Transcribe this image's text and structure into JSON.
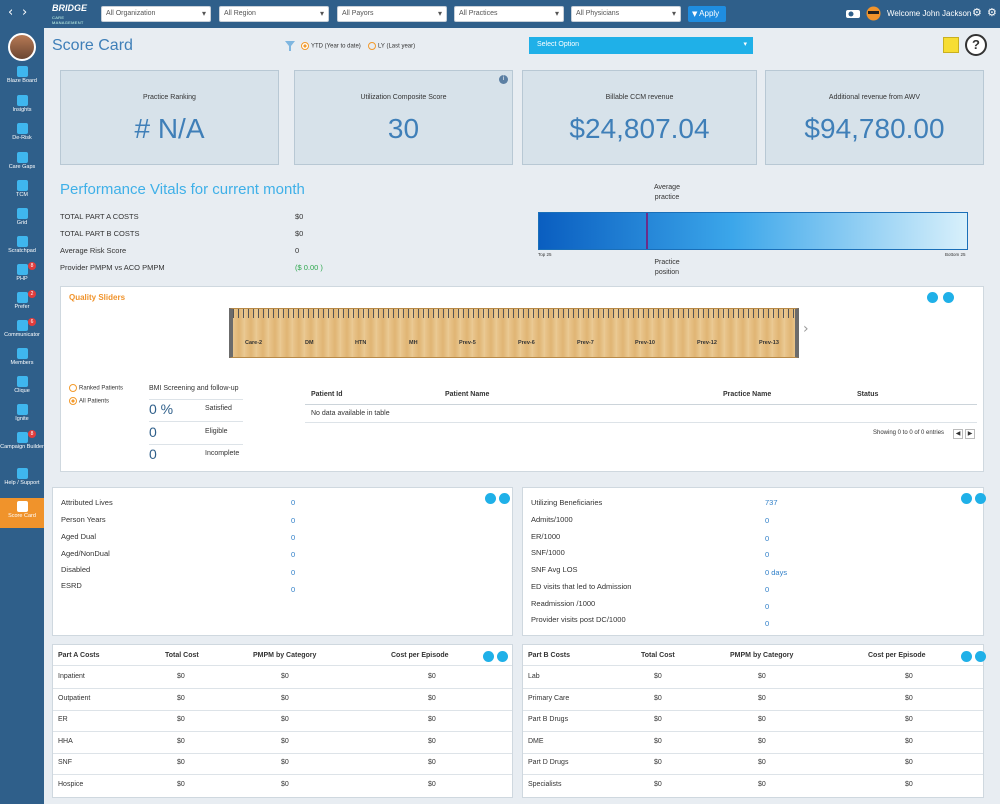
{
  "topbar": {
    "logo_text": "BRIDGE",
    "logo_sub": "CARE MANAGEMENT",
    "filters": [
      "All Organization",
      "All Region",
      "All Payors",
      "All Practices",
      "All Physicians"
    ],
    "apply_label": "Apply",
    "welcome": "Welcome John Jackson"
  },
  "sidebar": {
    "items": [
      {
        "label": "Blaze Board",
        "badge": ""
      },
      {
        "label": "Insights",
        "badge": ""
      },
      {
        "label": "De-Risk",
        "badge": ""
      },
      {
        "label": "Care Gaps",
        "badge": ""
      },
      {
        "label": "TCM",
        "badge": ""
      },
      {
        "label": "Grid",
        "badge": ""
      },
      {
        "label": "Scratchpad",
        "badge": ""
      },
      {
        "label": "PHP",
        "badge": "8"
      },
      {
        "label": "Prefer",
        "badge": "2"
      },
      {
        "label": "Communicator",
        "badge": "6"
      },
      {
        "label": "Members",
        "badge": ""
      },
      {
        "label": "Clique",
        "badge": ""
      },
      {
        "label": "Ignite",
        "badge": ""
      },
      {
        "label": "Campaign Builder",
        "badge": "8"
      },
      {
        "label": "Help / Support",
        "badge": ""
      },
      {
        "label": "Score Card",
        "badge": ""
      }
    ]
  },
  "header": {
    "title": "Score Card",
    "radio_ytd": "YTD (Year to date)",
    "radio_ly": "LY (Last year)",
    "select_option": "Select Option"
  },
  "kpis": [
    {
      "label": "Practice Ranking",
      "value": "# N/A"
    },
    {
      "label": "Utilization Composite Score",
      "value": "30"
    },
    {
      "label": "Billable CCM revenue",
      "value": "$24,807.04"
    },
    {
      "label": "Additional revenue from AWV",
      "value": "$94,780.00"
    }
  ],
  "vitals": {
    "title": "Performance Vitals for current month",
    "rows": [
      {
        "label": "TOTAL PART A COSTS",
        "value": "$0"
      },
      {
        "label": "TOTAL PART B COSTS",
        "value": "$0"
      },
      {
        "label": "Average Risk Score",
        "value": "0"
      },
      {
        "label": "Provider PMPM vs ACO PMPM",
        "value": "($ 0.00 )"
      }
    ],
    "gradient_top_label": "Average practice",
    "gradient_bottom_label": "Practice position",
    "gradient_left": "Top 25",
    "gradient_right": "Bottom 25",
    "average_marker_fraction": 0.25
  },
  "quality": {
    "title": "Quality Sliders",
    "ruler_ticks": [
      "Care-2",
      "DM",
      "HTN",
      "MH",
      "Prev-5",
      "Prev-6",
      "Prev-7",
      "Prev-10",
      "Prev-12",
      "Prev-13"
    ],
    "radio_ranked": "Ranked Patients",
    "radio_all": "All Patients",
    "bmi_title": "BMI Screening and follow-up",
    "stats": [
      {
        "value": "0 %",
        "label": "Satisfied"
      },
      {
        "value": "0",
        "label": "Eligible"
      },
      {
        "value": "0",
        "label": "Incomplete"
      }
    ],
    "table_headers": [
      "Patient Id",
      "Patient Name",
      "Practice Name",
      "Status"
    ],
    "no_data": "No data available in table",
    "showing": "Showing 0 to 0 of 0 entries"
  },
  "lives": [
    {
      "label": "Attributed Lives",
      "value": "0"
    },
    {
      "label": "Person Years",
      "value": "0"
    },
    {
      "label": "Aged Dual",
      "value": "0"
    },
    {
      "label": "Aged/NonDual",
      "value": "0"
    },
    {
      "label": "Disabled",
      "value": "0"
    },
    {
      "label": "ESRD",
      "value": "0"
    }
  ],
  "utilization": [
    {
      "label": "Utilizing Beneficiaries",
      "value": "737"
    },
    {
      "label": "Admits/1000",
      "value": "0"
    },
    {
      "label": "ER/1000",
      "value": "0"
    },
    {
      "label": "SNF/1000",
      "value": "0"
    },
    {
      "label": "SNF Avg LOS",
      "value": "0 days"
    },
    {
      "label": "ED visits that led to Admission",
      "value": "0"
    },
    {
      "label": "Readmission /1000",
      "value": "0"
    },
    {
      "label": "Provider visits post DC/1000",
      "value": "0"
    }
  ],
  "part_a": {
    "headers": [
      "Part A Costs",
      "Total Cost",
      "PMPM by Category",
      "Cost per Episode"
    ],
    "rows": [
      [
        "Inpatient",
        "$0",
        "$0",
        "$0"
      ],
      [
        "Outpatient",
        "$0",
        "$0",
        "$0"
      ],
      [
        "ER",
        "$0",
        "$0",
        "$0"
      ],
      [
        "HHA",
        "$0",
        "$0",
        "$0"
      ],
      [
        "SNF",
        "$0",
        "$0",
        "$0"
      ],
      [
        "Hospice",
        "$0",
        "$0",
        "$0"
      ]
    ]
  },
  "part_b": {
    "headers": [
      "Part B Costs",
      "Total Cost",
      "PMPM by Category",
      "Cost per Episode"
    ],
    "rows": [
      [
        "Lab",
        "$0",
        "$0",
        "$0"
      ],
      [
        "Primary Care",
        "$0",
        "$0",
        "$0"
      ],
      [
        "Part B Drugs",
        "$0",
        "$0",
        "$0"
      ],
      [
        "DME",
        "$0",
        "$0",
        "$0"
      ],
      [
        "Part D Drugs",
        "$0",
        "$0",
        "$0"
      ],
      [
        "Specialists",
        "$0",
        "$0",
        "$0"
      ]
    ]
  },
  "colors": {
    "brand": "#2f5f8a",
    "accent": "#1fb0e8",
    "active": "#f0932b",
    "value_blue": "#3f7fb8"
  }
}
